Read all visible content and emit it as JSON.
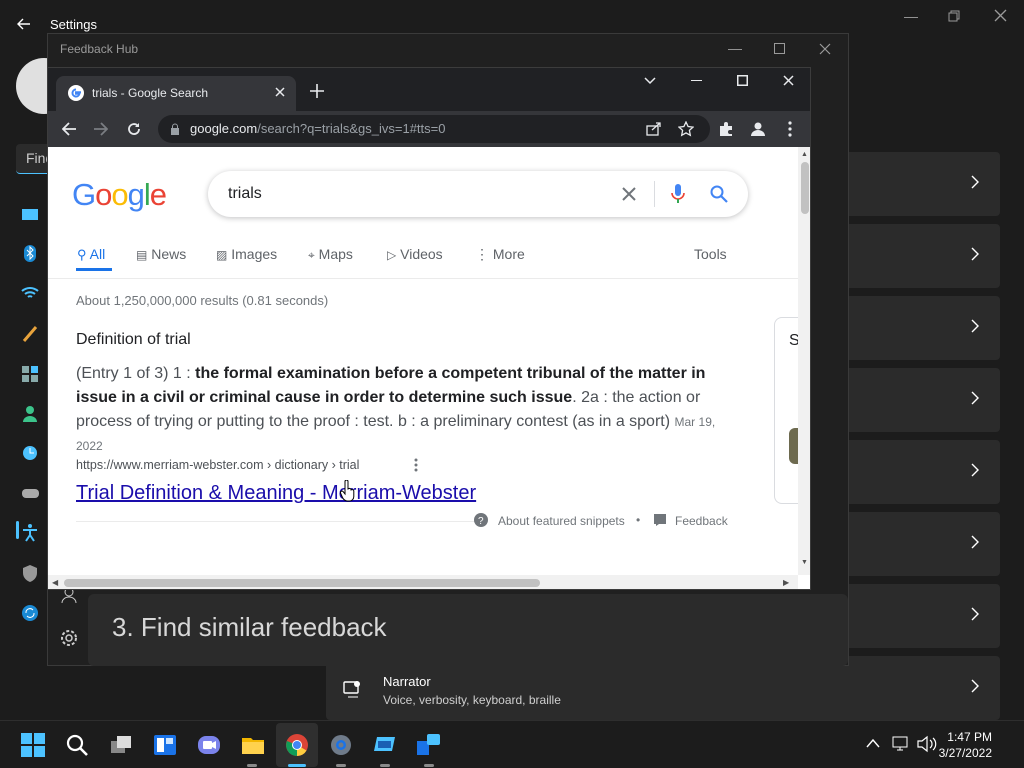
{
  "settings": {
    "title": "Settings",
    "search_placeholder": "Find",
    "narrator": {
      "title": "Narrator",
      "subtitle": "Voice, verbosity, keyboard, braille"
    }
  },
  "feedback_hub": {
    "title": "Feedback Hub",
    "step_text": "3. Find similar feedback"
  },
  "chrome": {
    "tab_title": "trials - Google Search",
    "url_domain": "google.com",
    "url_path": "/search?q=trials&gs_ivs=1#tts=0"
  },
  "google": {
    "logo": "Google",
    "query": "trials",
    "tabs": [
      "All",
      "News",
      "Images",
      "Maps",
      "Videos",
      "More"
    ],
    "tools": "Tools",
    "result_stats": "About 1,250,000,000 results (0.81 seconds)",
    "definition_heading": "Definition of trial",
    "snippet_prefix": "(Entry 1 of 3) 1 : ",
    "snippet_bold": "the formal examination before a competent tribunal of the matter in issue in a civil or criminal cause in order to determine such issue",
    "snippet_suffix": ". 2a : the action or process of trying or putting to the proof : test. b : a preliminary contest (as in a sport)",
    "snippet_date": "Mar 19, 2022",
    "cite": "https://www.merriam-webster.com › dictionary › trial",
    "result_title": "Trial Definition & Meaning - Merriam-Webster",
    "about_snippets": "About featured snippets",
    "feedback": "Feedback",
    "side_panel_letter": "S"
  },
  "taskbar": {
    "time": "1:47 PM",
    "date": "3/27/2022"
  },
  "colors": {
    "google_blue": "#4285f4",
    "google_red": "#ea4335",
    "google_yellow": "#fbbc05",
    "google_green": "#34a853",
    "link": "#1a0dab",
    "accent": "#4cc2ff"
  }
}
